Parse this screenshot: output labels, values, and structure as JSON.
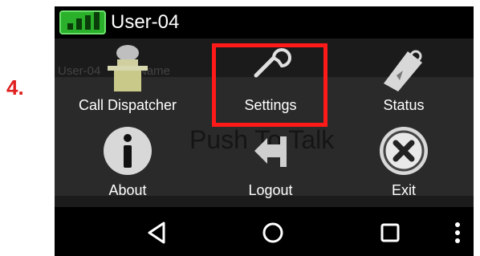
{
  "step_label": "4.",
  "app": {
    "title": "User-04",
    "signal_icon": "signal-strength-icon"
  },
  "background": {
    "user_text": "User-04",
    "name_text": "Name",
    "ptt_text": "Push To Talk"
  },
  "menu": {
    "items": [
      {
        "label": "Call Dispatcher",
        "icon": "dispatcher-desk-icon"
      },
      {
        "label": "Settings",
        "icon": "wrench-icon"
      },
      {
        "label": "Status",
        "icon": "tag-icon"
      },
      {
        "label": "About",
        "icon": "info-icon"
      },
      {
        "label": "Logout",
        "icon": "logout-icon"
      },
      {
        "label": "Exit",
        "icon": "close-circle-icon"
      }
    ],
    "highlighted": "Settings"
  },
  "navbar": {
    "back": "back-triangle-icon",
    "home": "home-circle-icon",
    "recents": "recents-square-icon",
    "more": "overflow-dots-icon"
  },
  "colors": {
    "highlight": "#ff1a1a",
    "step": "#e02020",
    "signal": "#2ab02a"
  }
}
